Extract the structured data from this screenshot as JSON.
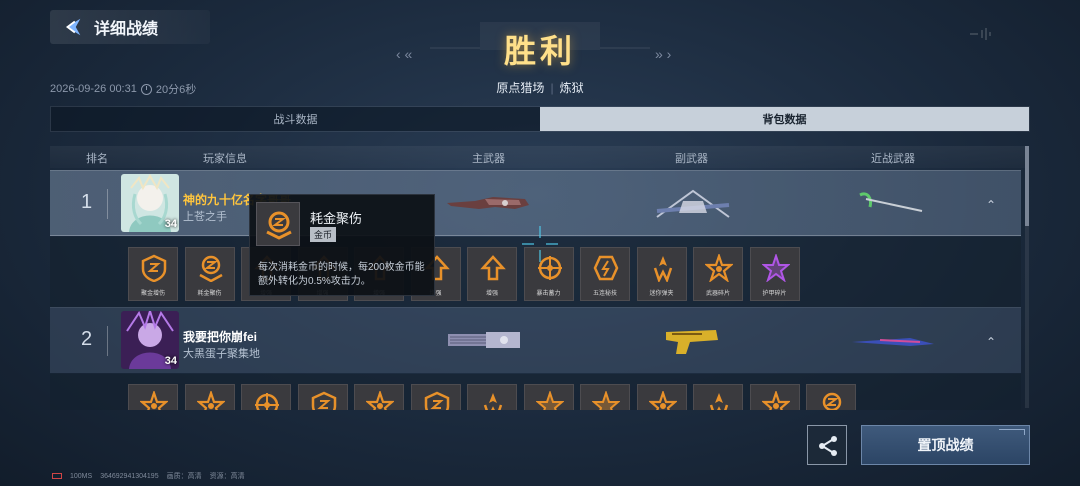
{
  "header": {
    "back_label": "详细战绩",
    "result": "胜利",
    "nav_prev": "‹ «",
    "nav_next": "» ›",
    "mode": "原点猎场",
    "difficulty": "炼狱",
    "date": "2026-09-26 00:31",
    "duration": "20分6秒"
  },
  "tabs": [
    {
      "label": "战斗数据",
      "active": false
    },
    {
      "label": "背包数据",
      "active": true
    }
  ],
  "table": {
    "columns": {
      "rank": "排名",
      "player": "玩家信息",
      "primary": "主武器",
      "secondary": "副武器",
      "melee": "近战武器"
    }
  },
  "players": [
    {
      "rank": "1",
      "name": "神的九十亿名字哥哥",
      "title": "上苍之手",
      "level": "34",
      "name_color": "#ffc53d",
      "collapse": "⌃"
    },
    {
      "rank": "2",
      "name": "我要把你崩fei",
      "title": "大黑蛋子聚集地",
      "level": "34",
      "name_color": "#ffffff",
      "collapse": "⌃"
    }
  ],
  "bag1_items": [
    {
      "label": "聚金增伤",
      "icon": "gold-coin-shield-icon"
    },
    {
      "label": "耗金聚伤",
      "icon": "gold-coin-hand-icon"
    },
    {
      "label": "增强",
      "icon": "arrow-up-icon"
    },
    {
      "label": "增强",
      "icon": "arrow-up-icon"
    },
    {
      "label": "增强",
      "icon": "arrow-up-icon"
    },
    {
      "label": "增强",
      "icon": "arrow-up-icon"
    },
    {
      "label": "增强",
      "icon": "arrow-up-icon"
    },
    {
      "label": "暴击蓄力",
      "icon": "crit-target-icon"
    },
    {
      "label": "五连秘技",
      "icon": "five-chain-icon"
    },
    {
      "label": "迷你弹夹",
      "icon": "mini-clip-icon"
    },
    {
      "label": "武器碎片",
      "icon": "star-shard-icon"
    },
    {
      "label": "护甲碎片",
      "icon": "armor-shard-icon"
    }
  ],
  "bag2_item_count": 13,
  "tooltip": {
    "name": "耗金聚伤",
    "badge": "金币",
    "description": "每次消耗金币的时候，每200枚金币能额外转化为0.5%攻击力。"
  },
  "buttons": {
    "pin": "置顶战绩"
  },
  "status": {
    "ping": "100MS",
    "id": "364692941304195",
    "quality": "画质：高清",
    "resource": "资源：高清"
  },
  "colors": {
    "accent_gold": "#ffe08a",
    "item_orange": "#e8912a",
    "item_purple": "#b056e6"
  }
}
